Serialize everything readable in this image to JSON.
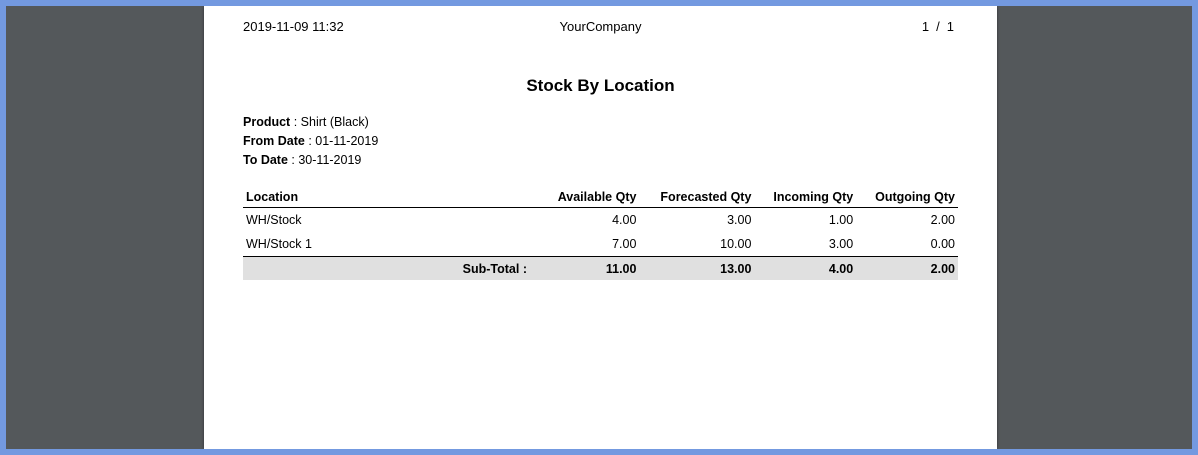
{
  "report": {
    "print_datetime": "2019-11-09 11:32",
    "company": "YourCompany",
    "page_current": "1",
    "page_separator": "/",
    "page_total": "1",
    "title": "Stock By Location",
    "filters": {
      "product_label": "Product",
      "product_value": ": Shirt (Black)",
      "from_date_label": "From Date",
      "from_date_value": ": 01-11-2019",
      "to_date_label": "To Date",
      "to_date_value": ": 30-11-2019"
    },
    "table": {
      "headers": [
        "Location",
        "Available Qty",
        "Forecasted Qty",
        "Incoming Qty",
        "Outgoing Qty"
      ],
      "rows": [
        [
          "WH/Stock",
          "4.00",
          "3.00",
          "1.00",
          "2.00"
        ],
        [
          "WH/Stock 1",
          "7.00",
          "10.00",
          "3.00",
          "0.00"
        ]
      ],
      "subtotal": {
        "label": "Sub-Total :",
        "values": [
          "11.00",
          "13.00",
          "4.00",
          "2.00"
        ]
      }
    }
  },
  "colors": {
    "viewer_frame": "#7399e0",
    "viewer_background": "#54585b",
    "page_background": "#ffffff",
    "subtotal_background": "#e0e0e0"
  }
}
